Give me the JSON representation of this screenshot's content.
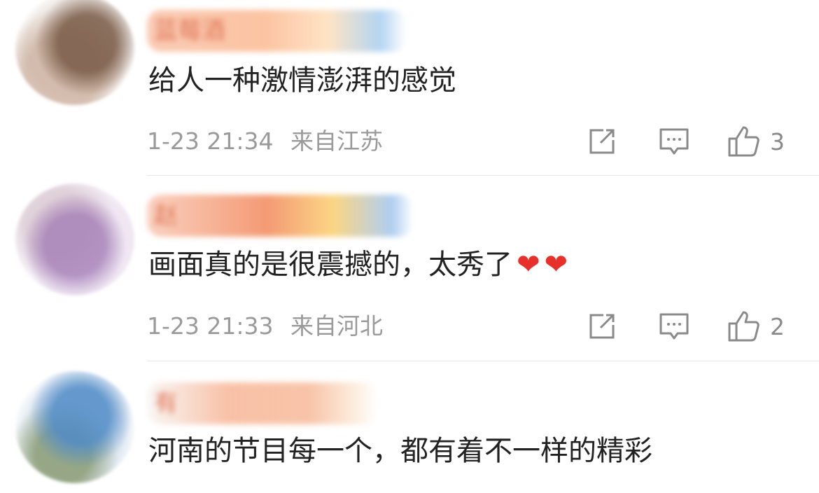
{
  "comments": [
    {
      "username": "蓝莓酒",
      "content": "给人一种激情澎湃的感觉",
      "time": "1-23 21:34",
      "location": "来自江苏",
      "likes": "3"
    },
    {
      "username": "赵",
      "content": "画面真的是很震撼的，太秀了",
      "hearts": [
        "❤",
        "❤"
      ],
      "time": "1-23 21:33",
      "location": "来自河北",
      "likes": "2"
    },
    {
      "username": "有",
      "content": "河南的节目每一个，都有着不一样的精彩"
    }
  ],
  "icons": {
    "share": "share-icon",
    "comment": "comment-icon",
    "like": "thumbs-up-icon"
  },
  "colors": {
    "heart": "#e8302a",
    "meta_text": "#9a9a9a",
    "icon_stroke": "#8a8a8a"
  }
}
